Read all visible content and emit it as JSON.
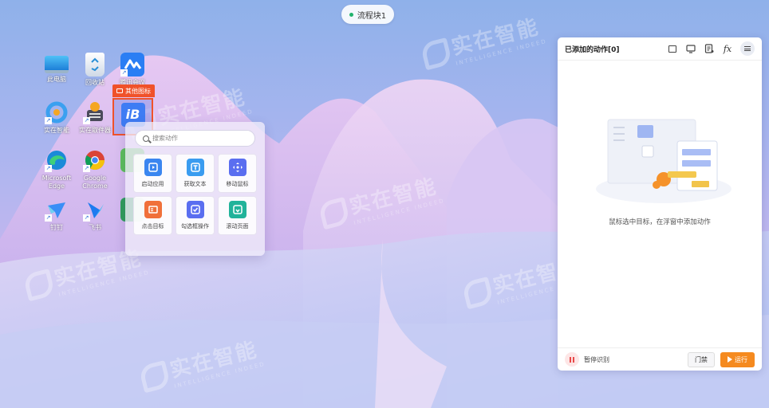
{
  "flow_pill": {
    "label": "流程块1"
  },
  "watermark": {
    "main": "实在智能",
    "sub": "INTELLIGENCE INDEED"
  },
  "desktop_icons": [
    {
      "label": "此电脑"
    },
    {
      "label": "回收站"
    },
    {
      "label": "腾讯会议"
    },
    {
      "label": "实在智能"
    },
    {
      "label": "实在取件器"
    },
    {
      "label": "Microsoft Edge"
    },
    {
      "label": "Google Chrome"
    },
    {
      "label": "钉钉"
    },
    {
      "label": "飞书"
    }
  ],
  "target_tag": {
    "label": "其他图标"
  },
  "action_popup": {
    "search_placeholder": "搜索动作",
    "actions": [
      {
        "label": "启动应用",
        "color": "#3a86f0"
      },
      {
        "label": "获取文本",
        "color": "#3a9cf0"
      },
      {
        "label": "移动鼠标",
        "color": "#5a6ef0"
      },
      {
        "label": "点击目标",
        "color": "#f0703a"
      },
      {
        "label": "勾选框操作",
        "color": "#5a6ef0"
      },
      {
        "label": "滚动页面",
        "color": "#21b39a"
      }
    ]
  },
  "panel": {
    "title": "已添加的动作[0]",
    "tools": [
      "screenshot-icon",
      "monitor-icon",
      "list-doc-icon",
      "fx-icon",
      "menu-icon"
    ],
    "fx_label": "fx",
    "empty_message": "鼠标选中目标，在浮窗中添加动作",
    "pause_label": "暂停识别",
    "record_label": "门禁",
    "run_label": "运行"
  }
}
